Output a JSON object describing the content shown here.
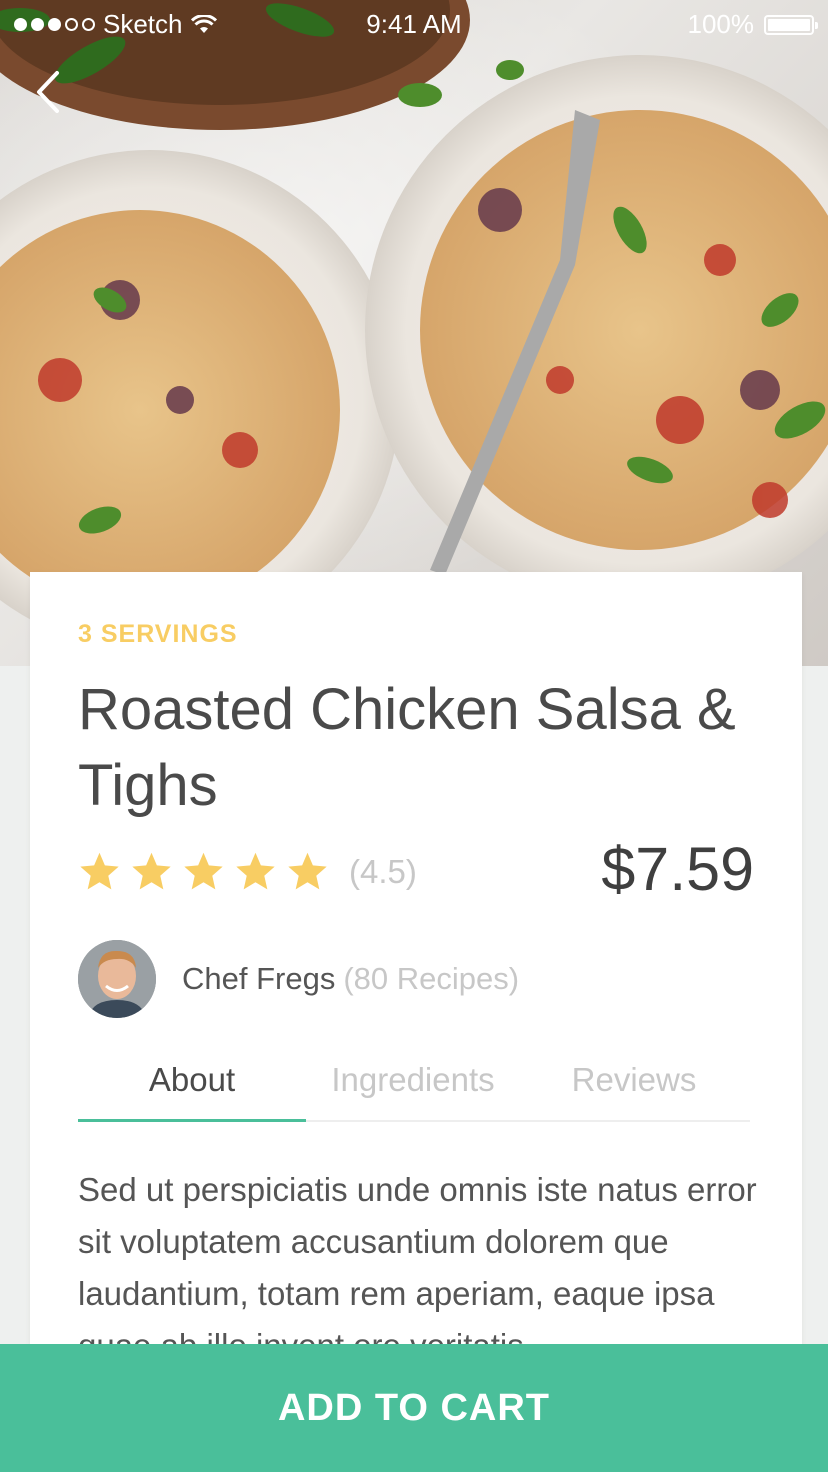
{
  "status_bar": {
    "carrier": "Sketch",
    "time": "9:41 AM",
    "battery": "100%"
  },
  "recipe": {
    "servings": "3 SERVINGS",
    "title": "Roasted Chicken Salsa & Tighs",
    "rating": {
      "stars": 5,
      "label": "(4.5)"
    },
    "price": "$7.59"
  },
  "chef": {
    "name": "Chef Fregs",
    "recipes": "(80 Recipes)"
  },
  "tabs": [
    {
      "label": "About",
      "active": true
    },
    {
      "label": "Ingredients",
      "active": false
    },
    {
      "label": "Reviews",
      "active": false
    }
  ],
  "about": {
    "text": "Sed ut perspiciatis unde omnis iste natus error sit voluptatem accusantium dolorem que laudantium, totam rem aperiam, eaque ipsa quae ab illo invent ore veritatis"
  },
  "cart": {
    "label": "ADD TO CART"
  },
  "colors": {
    "accent": "#4abf9a",
    "servings": "#f8cd63",
    "star": "#f8cd63"
  }
}
